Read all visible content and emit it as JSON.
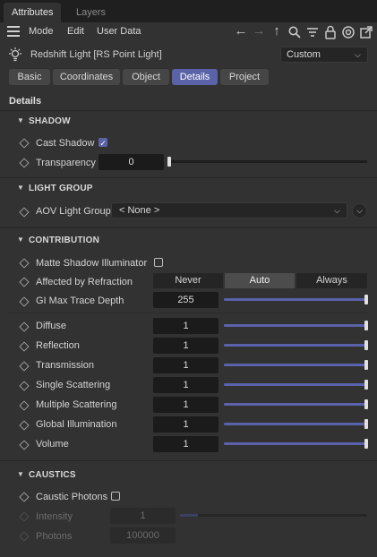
{
  "tabs": {
    "attributes": "Attributes",
    "layers": "Layers"
  },
  "menu": {
    "mode": "Mode",
    "edit": "Edit",
    "user_data": "User Data"
  },
  "toolbar_icons": [
    "back-arrow-icon",
    "forward-arrow-icon",
    "up-arrow-icon",
    "search-icon",
    "filter-icon",
    "lock-icon",
    "target-icon",
    "new-window-icon"
  ],
  "object": {
    "title": "Redshift Light [RS Point Light]",
    "preset": "Custom"
  },
  "subtabs": [
    "Basic",
    "Coordinates",
    "Object",
    "Details",
    "Project"
  ],
  "selected_subtab": "Details",
  "heading": "Details",
  "shadow": {
    "title": "SHADOW",
    "cast_shadow_label": "Cast Shadow",
    "cast_shadow": true,
    "transparency_label": "Transparency",
    "transparency_value": "0",
    "transparency_level": 0
  },
  "light_group": {
    "title": "LIGHT GROUP",
    "aov_label": "AOV Light Group",
    "aov_value": "< None >"
  },
  "contribution": {
    "title": "CONTRIBUTION",
    "matte_label": "Matte Shadow Illuminator",
    "matte": false,
    "refraction_label": "Affected by Refraction",
    "refraction_options": [
      "Never",
      "Auto",
      "Always"
    ],
    "refraction_selected": "Auto",
    "gi_label": "GI Max Trace Depth",
    "gi_value": "255",
    "gi_level": 1.0,
    "rows": [
      {
        "label": "Diffuse",
        "value": "1",
        "level": 1.0
      },
      {
        "label": "Reflection",
        "value": "1",
        "level": 1.0
      },
      {
        "label": "Transmission",
        "value": "1",
        "level": 1.0
      },
      {
        "label": "Single Scattering",
        "value": "1",
        "level": 1.0
      },
      {
        "label": "Multiple Scattering",
        "value": "1",
        "level": 1.0
      },
      {
        "label": "Global Illumination",
        "value": "1",
        "level": 1.0
      },
      {
        "label": "Volume",
        "value": "1",
        "level": 1.0
      }
    ]
  },
  "caustics": {
    "title": "CAUSTICS",
    "photons_label": "Caustic Photons",
    "caustic_photons": false,
    "intensity_label": "Intensity",
    "intensity_value": "1",
    "photons_count_label": "Photons",
    "photons_count_value": "100000"
  },
  "colors": {
    "accent": "#5b63a8",
    "slider": "#5a62ab",
    "background": "#323232"
  }
}
